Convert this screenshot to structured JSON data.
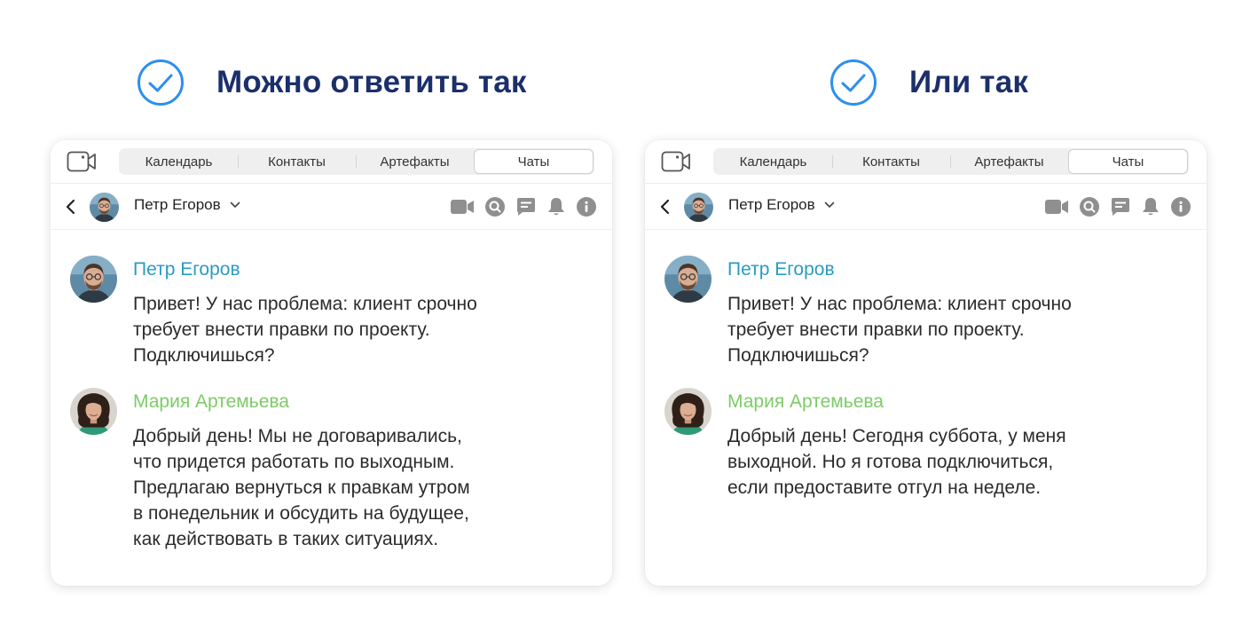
{
  "colors": {
    "check": "#2c8ff0",
    "title": "#1b2f6b",
    "sender_peter": "#2a9bc2",
    "sender_maria": "#7ccb66",
    "icon_gray": "#8f8f8f"
  },
  "left": {
    "headline": "Можно ответить так",
    "tabs": [
      "Календарь",
      "Контакты",
      "Артефакты",
      "Чаты"
    ],
    "active_tab": 3,
    "chat_title": "Петр Егоров",
    "messages": [
      {
        "sender": "Петр Егоров",
        "lines": [
          "Привет! У нас проблема: клиент срочно",
          "требует внести правки по проекту.",
          "Подключишься?"
        ]
      },
      {
        "sender": "Мария Артемьева",
        "lines": [
          "Добрый день! Мы не договаривались,",
          "что придется работать по выходным.",
          "Предлагаю вернуться к правкам утром",
          "в понедельник и обсудить на будущее,",
          "как действовать в таких ситуациях."
        ]
      }
    ]
  },
  "right": {
    "headline": "Или так",
    "tabs": [
      "Календарь",
      "Контакты",
      "Артефакты",
      "Чаты"
    ],
    "active_tab": 3,
    "chat_title": "Петр Егоров",
    "messages": [
      {
        "sender": "Петр Егоров",
        "lines": [
          "Привет! У нас проблема: клиент срочно",
          "требует внести правки по проекту.",
          "Подключишься?"
        ]
      },
      {
        "sender": "Мария Артемьева",
        "lines": [
          "Добрый день! Сегодня суббота, у меня",
          "выходной. Но я готова подключиться,",
          "если предоставите отгул на неделе."
        ]
      }
    ]
  },
  "icons": [
    "check-circle-icon",
    "video-call-icon",
    "back-icon",
    "chevron-down-icon",
    "video-icon",
    "search-icon",
    "chat-icon",
    "bell-icon",
    "info-icon"
  ]
}
